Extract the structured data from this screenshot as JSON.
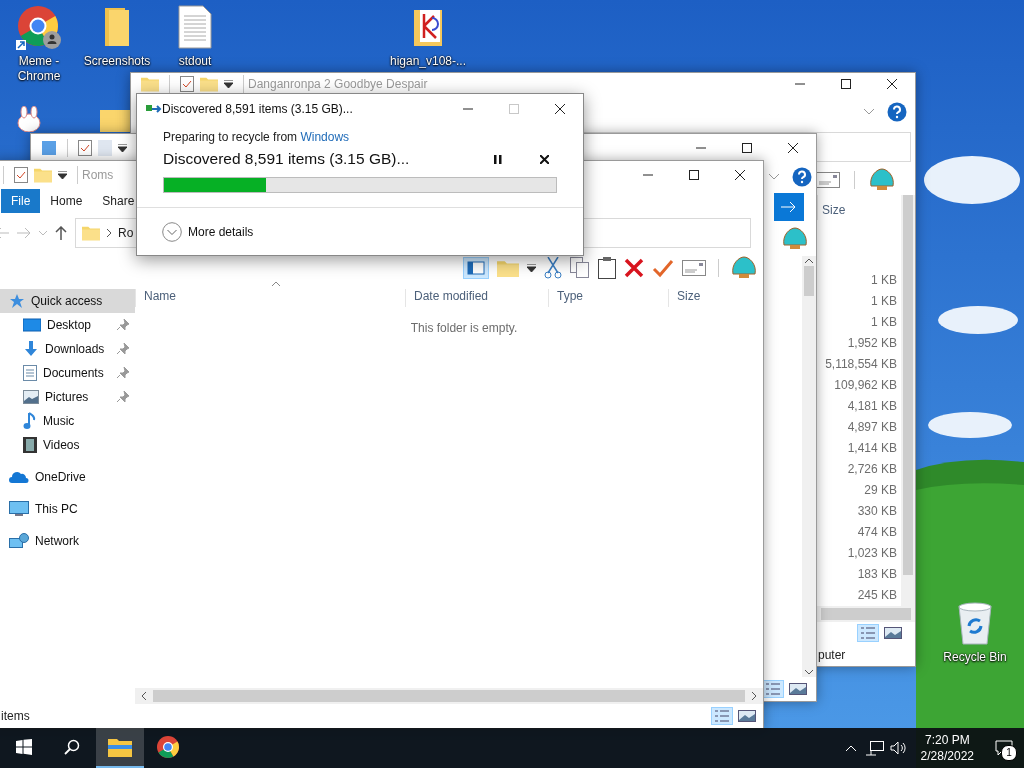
{
  "desktop_icons": [
    {
      "label": "Meme - Chrome",
      "kind": "chrome"
    },
    {
      "label": "Screenshots",
      "kind": "folder"
    },
    {
      "label": "stdout",
      "kind": "document"
    },
    {
      "label": "higan_v108-...",
      "kind": "archive"
    },
    {
      "label": "Recycle Bin",
      "kind": "recycle-bin"
    }
  ],
  "back_window": {
    "title": "Danganronpa 2 Goodbye Despair",
    "size_header": "Size",
    "sizes": [
      "1 KB",
      "1 KB",
      "1 KB",
      "1,952 KB",
      "5,118,554 KB",
      "109,962 KB",
      "4,181 KB",
      "4,897 KB",
      "1,414 KB",
      "2,726 KB",
      "29 KB",
      "330 KB",
      "474 KB",
      "1,023 KB",
      "183 KB",
      "245 KB"
    ],
    "status": "puter"
  },
  "explorer": {
    "title": "Roms",
    "tabs": [
      {
        "label": "File",
        "kind": "menu"
      },
      {
        "label": "Home",
        "kind": "tab"
      },
      {
        "label": "Share",
        "kind": "tab"
      }
    ],
    "address": "Ro",
    "columns": [
      "Name",
      "Date modified",
      "Type",
      "Size"
    ],
    "empty_message": "This folder is empty.",
    "nav": [
      {
        "label": "Quick access",
        "kind": "star",
        "selected": true,
        "children": [
          {
            "label": "Desktop",
            "kind": "desktop",
            "selected": false,
            "pinned": true
          },
          {
            "label": "Downloads",
            "kind": "download",
            "selected": false,
            "pinned": true
          },
          {
            "label": "Documents",
            "kind": "document",
            "selected": false,
            "pinned": true
          },
          {
            "label": "Pictures",
            "kind": "picture",
            "selected": false,
            "pinned": true
          },
          {
            "label": "Music",
            "kind": "music",
            "selected": false,
            "pinned": false
          },
          {
            "label": "Videos",
            "kind": "video",
            "selected": false,
            "pinned": false
          }
        ]
      },
      {
        "label": "OneDrive",
        "kind": "cloud",
        "selected": false
      },
      {
        "label": "This PC",
        "kind": "pc",
        "selected": false
      },
      {
        "label": "Network",
        "kind": "network",
        "selected": false
      }
    ],
    "status": "items"
  },
  "dialog": {
    "title": "Discovered 8,591 items (3.15 GB)...",
    "source_prefix": "Preparing to recycle from ",
    "source_link": "Windows",
    "heading": "Discovered 8,591 items (3.15 GB)...",
    "progress": {
      "level": 0.26
    },
    "details_label": "More details"
  },
  "taskbar": {
    "apps": [
      {
        "kind": "explorer",
        "active": true
      },
      {
        "kind": "chrome",
        "active": false
      }
    ],
    "time": "7:20 PM",
    "date": "2/28/2022",
    "notifications": "1"
  }
}
